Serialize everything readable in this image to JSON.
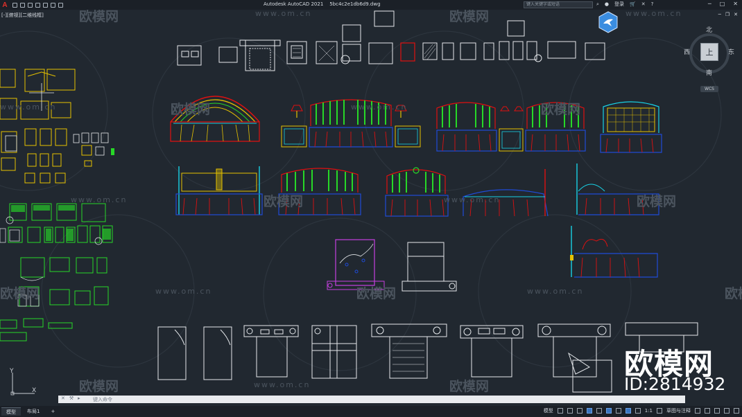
{
  "titlebar": {
    "app_name": "Autodesk AutoCAD 2021",
    "file_name": "5bc4c2e1db6d9.dwg",
    "search_placeholder": "键入关键字或短语",
    "login_label": "登录",
    "icons": [
      "app-logo",
      "new-icon",
      "open-icon",
      "save-icon",
      "saveas-icon",
      "print-icon",
      "undo-icon",
      "redo-icon"
    ]
  },
  "viewport": {
    "label": "[-][俯视][二维线框]"
  },
  "viewcube": {
    "north": "北",
    "south": "南",
    "east": "东",
    "west": "西",
    "face": "上",
    "wcs": "WCS"
  },
  "watermarks": {
    "brand": "欧模网",
    "url": "www.om.cn",
    "id": "ID:2814932"
  },
  "command": {
    "placeholder": "键入命令"
  },
  "statusbar": {
    "tabs": [
      "模型",
      "布局1"
    ],
    "add_tab": "+",
    "model_label": "模型",
    "scale": "1:1",
    "annotation": "草图与注释"
  },
  "colors": {
    "background": "#212830",
    "yellow": "#e6c200",
    "green": "#27d827",
    "red": "#e01010",
    "cyan": "#18d2e6",
    "blue": "#1f4bd8",
    "white": "#e6e9ec",
    "magenta": "#c63fe0"
  }
}
